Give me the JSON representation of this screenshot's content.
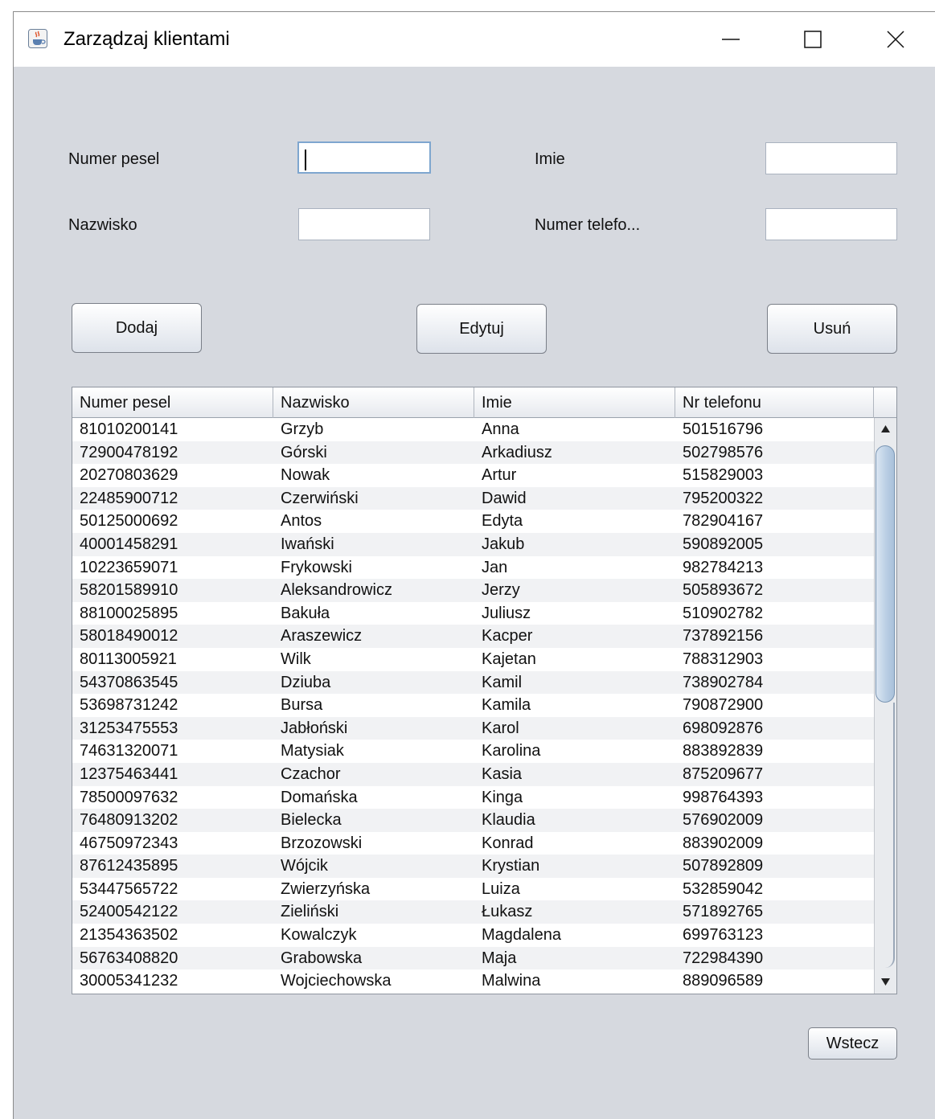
{
  "window": {
    "title": "Zarządzaj klientami"
  },
  "form": {
    "pesel_label": "Numer pesel",
    "pesel_value": "",
    "imie_label": "Imie",
    "imie_value": "",
    "nazwisko_label": "Nazwisko",
    "nazwisko_value": "",
    "telefon_label": "Numer telefo...",
    "telefon_value": ""
  },
  "actions": {
    "add": "Dodaj",
    "edit": "Edytuj",
    "delete": "Usuń",
    "back": "Wstecz"
  },
  "table": {
    "columns": [
      "Numer pesel",
      "Nazwisko",
      "Imie",
      "Nr telefonu"
    ],
    "rows": [
      [
        "81010200141",
        "Grzyb",
        "Anna",
        "501516796"
      ],
      [
        "72900478192",
        "Górski",
        "Arkadiusz",
        "502798576"
      ],
      [
        "20270803629",
        "Nowak",
        "Artur",
        "515829003"
      ],
      [
        "22485900712",
        "Czerwiński",
        "Dawid",
        "795200322"
      ],
      [
        "50125000692",
        "Antos",
        "Edyta",
        "782904167"
      ],
      [
        "40001458291",
        "Iwański",
        "Jakub",
        "590892005"
      ],
      [
        "10223659071",
        "Frykowski",
        "Jan",
        "982784213"
      ],
      [
        "58201589910",
        "Aleksandrowicz",
        "Jerzy",
        "505893672"
      ],
      [
        "88100025895",
        "Bakuła",
        "Juliusz",
        "510902782"
      ],
      [
        "58018490012",
        "Araszewicz",
        "Kacper",
        "737892156"
      ],
      [
        "80113005921",
        "Wilk",
        "Kajetan",
        "788312903"
      ],
      [
        "54370863545",
        "Dziuba",
        "Kamil",
        "738902784"
      ],
      [
        "53698731242",
        "Bursa",
        "Kamila",
        "790872900"
      ],
      [
        "31253475553",
        "Jabłoński",
        "Karol",
        "698092876"
      ],
      [
        "74631320071",
        "Matysiak",
        "Karolina",
        "883892839"
      ],
      [
        "12375463441",
        "Czachor",
        "Kasia",
        "875209677"
      ],
      [
        "78500097632",
        "Domańska",
        "Kinga",
        "998764393"
      ],
      [
        "76480913202",
        "Bielecka",
        "Klaudia",
        "576902009"
      ],
      [
        "46750972343",
        "Brzozowski",
        "Konrad",
        "883902009"
      ],
      [
        "87612435895",
        "Wójcik",
        "Krystian",
        "507892809"
      ],
      [
        "53447565722",
        "Zwierzyńska",
        "Luiza",
        "532859042"
      ],
      [
        "52400542122",
        "Zieliński",
        "Łukasz",
        "571892765"
      ],
      [
        "21354363502",
        "Kowalczyk",
        "Magdalena",
        "699763123"
      ],
      [
        "56763408820",
        "Grabowska",
        "Maja",
        "722984390"
      ],
      [
        "30005341232",
        "Wojciechowska",
        "Malwina",
        "889096589"
      ]
    ]
  },
  "icons": {
    "app": "java-cup-icon",
    "minimize": "minimize-icon",
    "maximize": "maximize-icon",
    "close": "close-icon",
    "scroll_up": "arrow-up-icon",
    "scroll_down": "arrow-down-icon"
  },
  "colors": {
    "window_bg": "#d6d9df",
    "titlebar_bg": "#ffffff",
    "focus_border": "#7ea6cf",
    "row_alt": "#f1f2f4"
  }
}
